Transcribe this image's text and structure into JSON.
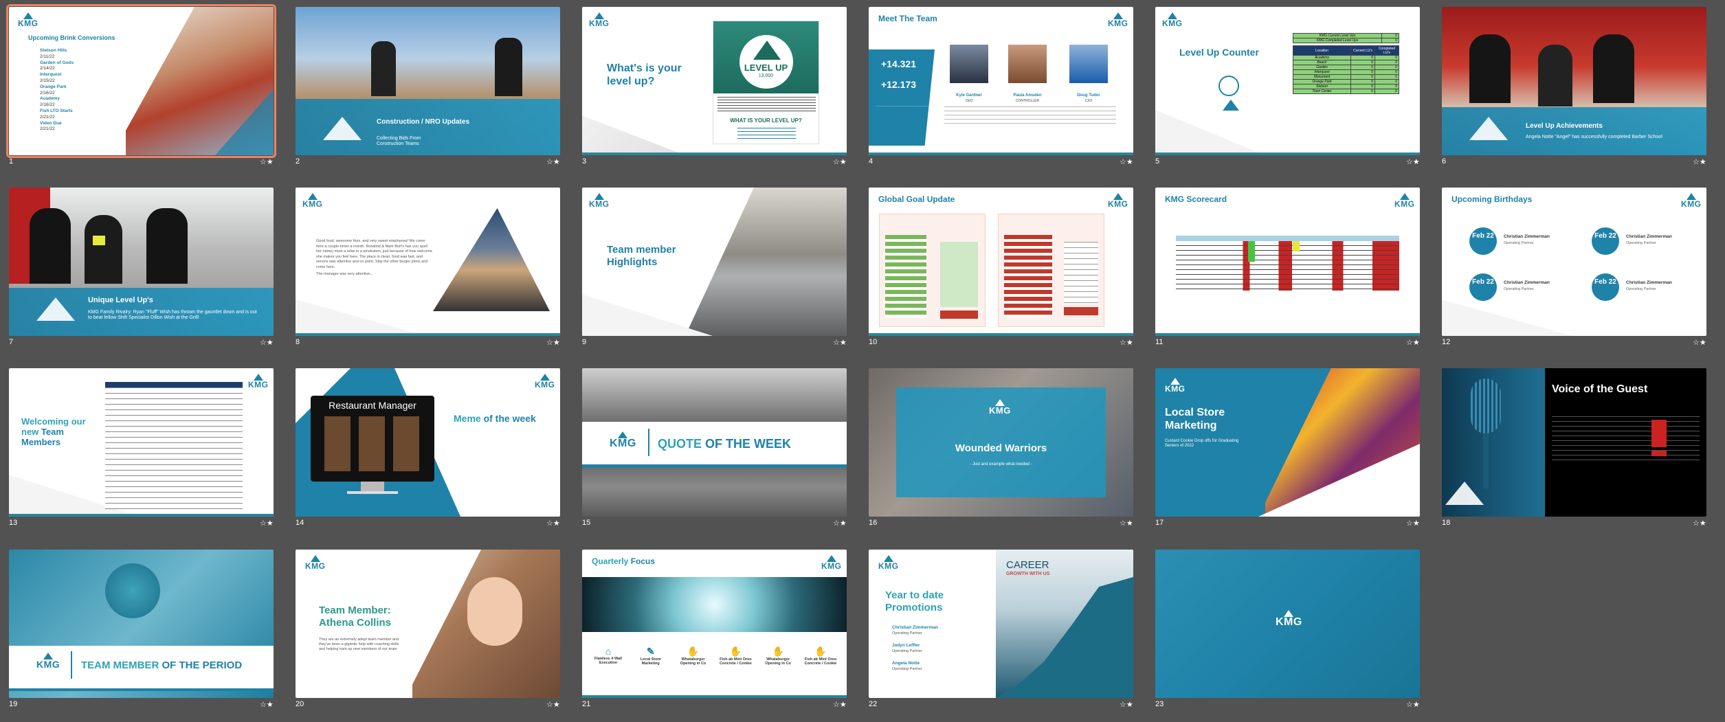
{
  "slides": [
    {
      "n": "1",
      "title": "Upcoming Brink Conversions",
      "items": [
        "Stetson Hills",
        "2/11/22",
        "Garden of Gods",
        "2/14/22",
        "Interquest",
        "2/15/22",
        "Orange Park",
        "2/16/22",
        "Academy",
        "2/16/22",
        "Fish LTO Starts",
        "2/21/22",
        "Video Due",
        "2/21/22"
      ]
    },
    {
      "n": "2",
      "title": "Construction / NRO Updates",
      "sub": "Collecting Bids From Construction Teams"
    },
    {
      "n": "3",
      "title": "What's is your level up?",
      "badge": "LEVEL UP",
      "badge_num": "13,000",
      "q": "WHAT IS YOUR LEVEL UP?"
    },
    {
      "n": "4",
      "title_a": "Meet The ",
      "title_b": "Team",
      "stat1": "+14.321",
      "stat2": "+12.173",
      "people": [
        {
          "name": "Kyle Gardner",
          "role": "CEO"
        },
        {
          "name": "Paula Amsden",
          "role": "CONTROLLER"
        },
        {
          "name": "Doug Tudor",
          "role": "CXO"
        }
      ]
    },
    {
      "n": "5",
      "title": "Level Up Counter",
      "t_head1": "KMG Current Level Ups",
      "t_head2": "KMG Completed Level Ups",
      "col1": "Location",
      "col2": "Current LU's",
      "col3": "Completed LU's",
      "rows": [
        "Academy",
        "Beach",
        "Garden",
        "Interquest",
        "Monument",
        "Orange Park",
        "Stetson",
        "Town Center"
      ]
    },
    {
      "n": "6",
      "title": "Level Up Achievements",
      "sub": "Angela Notte \"Angel\" has successfully completed Barber School"
    },
    {
      "n": "7",
      "title": "Unique Level Up's",
      "sub": "KMG Family Rivalry: Ryan \"Fluff\" Wish has thrown the gauntlet down and is out to beat fellow Shift Specialist Dillon Wish at the Grill!"
    },
    {
      "n": "8",
      "body": "Good food, awesome fries, and very sweet employees! We come here a couple times a month. Rosalind & Mark Burt's has you spell her name) most a relax in a pinstration, just because of how welcome she makes you feel here. The place is clean, food was fast, and service was attentive and on point. Skip the other burger joints and come here.",
      "body2": "The manager was very attentive..."
    },
    {
      "n": "9",
      "title": "Team member Highlights"
    },
    {
      "n": "10",
      "title_a": "Global Goal ",
      "title_b": "Update"
    },
    {
      "n": "11",
      "title": "KMG Scorecard"
    },
    {
      "n": "12",
      "title_a": "Upcoming ",
      "title_b": "Birthdays",
      "date": "Feb 22",
      "person": "Christian Zimmerman",
      "role": "Operating Partner"
    },
    {
      "n": "13",
      "title_a": "Welcoming our new ",
      "title_b": "Team Members"
    },
    {
      "n": "14",
      "title_a": "Meme ",
      "title_b": "of the week",
      "screen": "Restaurant Manager"
    },
    {
      "n": "15",
      "title_a": "QUOTE ",
      "title_b": "OF THE WEEK"
    },
    {
      "n": "16",
      "title": "Wounded Warriors",
      "sub": "- Just and example what needed -"
    },
    {
      "n": "17",
      "title": "Local Store Marketing",
      "sub": "Custard Cookie Drop offs for Graduating Seniors of 2022"
    },
    {
      "n": "18",
      "title": "Voice of the Guest"
    },
    {
      "n": "19",
      "title_a": "TEAM MEMBER ",
      "title_b": "OF THE PERIOD"
    },
    {
      "n": "20",
      "title": "Team Member: Athena Collins",
      "sub": "They are an extremely adept team member and they've been a gigantic help with coaching skills and helping train up new members of our team"
    },
    {
      "n": "21",
      "title_a": "Quarterly ",
      "title_b": "Focus",
      "items": [
        "Flawless 4 Wall Execution",
        "Local Store Marketing",
        "Whataburger Opening in Co",
        "Fish ab Mint Oreo Concrete / Cookie",
        "Whataburger Opening in Co",
        "Fish ab Mint Oreo Concrete / Cookie"
      ]
    },
    {
      "n": "22",
      "title": "Year to date Promotions",
      "items": [
        {
          "name": "Christian Zimmerman",
          "role": "Operating Partner"
        },
        {
          "name": "Jadyn Leffler",
          "role": "Operating Partner"
        },
        {
          "name": "Angela Notte",
          "role": "Operating Partner"
        }
      ],
      "career": "CAREER",
      "growth": "GROWTH WITH US"
    },
    {
      "n": "23"
    }
  ],
  "logo": "KMG",
  "star": "☆★"
}
